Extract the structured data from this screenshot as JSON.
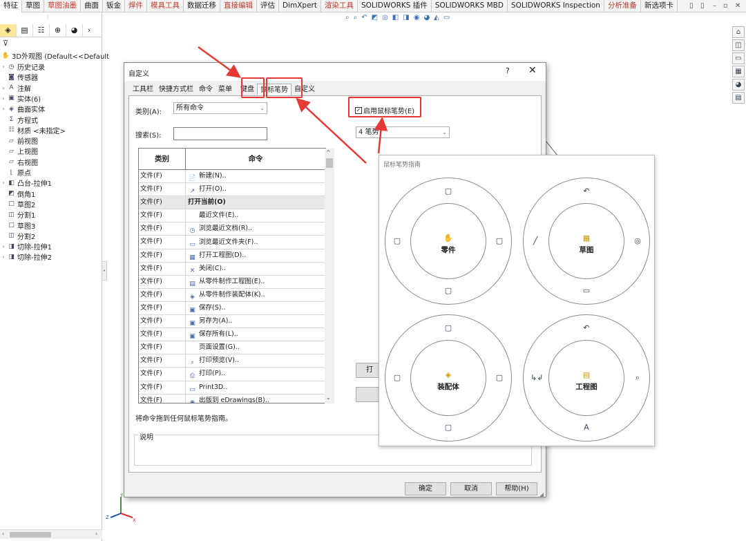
{
  "ribbon": {
    "tabs": [
      {
        "label": "特征",
        "style": "active"
      },
      {
        "label": "草图",
        "style": ""
      },
      {
        "label": "草图油墨",
        "style": "red"
      },
      {
        "label": "曲面",
        "style": ""
      },
      {
        "label": "钣金",
        "style": ""
      },
      {
        "label": "焊件",
        "style": "red"
      },
      {
        "label": "模具工具",
        "style": "red"
      },
      {
        "label": "数据迁移",
        "style": ""
      },
      {
        "label": "直接编辑",
        "style": "red"
      },
      {
        "label": "评估",
        "style": ""
      },
      {
        "label": "DimXpert",
        "style": ""
      },
      {
        "label": "渲染工具",
        "style": "red"
      },
      {
        "label": "SOLIDWORKS 插件",
        "style": ""
      },
      {
        "label": "SOLIDWORKS MBD",
        "style": ""
      },
      {
        "label": "SOLIDWORKS Inspection",
        "style": ""
      },
      {
        "label": "分析准备",
        "style": "red"
      },
      {
        "label": "新选项卡",
        "style": ""
      }
    ]
  },
  "tree": {
    "root": "3D外观图  (Default<<Default",
    "items": [
      {
        "label": "历史记录",
        "icon": "history-icon",
        "glyph": "◷",
        "expand": "›"
      },
      {
        "label": "传感器",
        "icon": "sensor-icon",
        "glyph": "◙",
        "expand": ""
      },
      {
        "label": "注解",
        "icon": "annotation-icon",
        "glyph": "A",
        "expand": "›"
      },
      {
        "label": "实体(6)",
        "icon": "solid-body-icon",
        "glyph": "▣",
        "expand": "›"
      },
      {
        "label": "曲面实体",
        "icon": "surface-body-icon",
        "glyph": "◈",
        "expand": "›"
      },
      {
        "label": "方程式",
        "icon": "equation-icon",
        "glyph": "Σ",
        "expand": ""
      },
      {
        "label": "材质 <未指定>",
        "icon": "material-icon",
        "glyph": "☷",
        "expand": ""
      },
      {
        "label": "前视图",
        "icon": "plane-icon",
        "glyph": "▱",
        "expand": ""
      },
      {
        "label": "上视图",
        "icon": "plane-icon",
        "glyph": "▱",
        "expand": ""
      },
      {
        "label": "右视图",
        "icon": "plane-icon",
        "glyph": "▱",
        "expand": ""
      },
      {
        "label": "原点",
        "icon": "origin-icon",
        "glyph": "⌊",
        "expand": ""
      },
      {
        "label": "凸台-拉伸1",
        "icon": "extrude-icon",
        "glyph": "◧",
        "expand": "›"
      },
      {
        "label": "倒角1",
        "icon": "chamfer-icon",
        "glyph": "◩",
        "expand": ""
      },
      {
        "label": "草图2",
        "icon": "sketch-icon",
        "glyph": "□",
        "expand": ""
      },
      {
        "label": "分割1",
        "icon": "split-icon",
        "glyph": "◫",
        "expand": ""
      },
      {
        "label": "草图3",
        "icon": "sketch-icon",
        "glyph": "□",
        "expand": ""
      },
      {
        "label": "分割2",
        "icon": "split-icon",
        "glyph": "◫",
        "expand": ""
      },
      {
        "label": "切除-拉伸1",
        "icon": "cut-extrude-icon",
        "glyph": "◨",
        "expand": "›"
      },
      {
        "label": "切除-拉伸2",
        "icon": "cut-extrude-icon",
        "glyph": "◨",
        "expand": "›"
      }
    ]
  },
  "dialog": {
    "title": "自定义",
    "help": "?",
    "close": "✕",
    "tabs": [
      "工具栏",
      "快捷方式栏",
      "命令",
      "菜单",
      "键盘",
      "鼠标笔势",
      "自定义"
    ],
    "category_label": "类别(A):",
    "category_value": "所有命令",
    "search_label": "搜索(S):",
    "enable_gestures_label": "启用鼠标笔势(E)",
    "gesture_count_value": "4 笔势",
    "table_headers": [
      "类别",
      "命令"
    ],
    "rows": [
      {
        "cat": "文件(F)",
        "cmd": "新建(N)..",
        "icon": "new-file-icon",
        "glyph": "📄",
        "hl": false
      },
      {
        "cat": "文件(F)",
        "cmd": "打开(O)..",
        "icon": "open-icon",
        "glyph": "↗",
        "hl": false
      },
      {
        "cat": "文件(F)",
        "cmd": "打开当前(O)",
        "icon": "",
        "glyph": "",
        "hl": true
      },
      {
        "cat": "文件(F)",
        "cmd": "最近文件(E)..",
        "icon": "",
        "glyph": "",
        "hl": false
      },
      {
        "cat": "文件(F)",
        "cmd": "浏览最近文档(R)..",
        "icon": "recent-docs-icon",
        "glyph": "◷",
        "hl": false
      },
      {
        "cat": "文件(F)",
        "cmd": "浏览最近文件夹(F)..",
        "icon": "recent-folder-icon",
        "glyph": "▭",
        "hl": false
      },
      {
        "cat": "文件(F)",
        "cmd": "打开工程图(D)..",
        "icon": "drawing-icon",
        "glyph": "▦",
        "hl": false
      },
      {
        "cat": "文件(F)",
        "cmd": "关闭(C)..",
        "icon": "close-doc-icon",
        "glyph": "✕",
        "hl": false
      },
      {
        "cat": "文件(F)",
        "cmd": "从零件制作工程图(E)..",
        "icon": "make-drawing-icon",
        "glyph": "▤",
        "hl": false
      },
      {
        "cat": "文件(F)",
        "cmd": "从零件制作装配体(K)..",
        "icon": "make-assembly-icon",
        "glyph": "◈",
        "hl": false
      },
      {
        "cat": "文件(F)",
        "cmd": "保存(S)..",
        "icon": "save-icon",
        "glyph": "▣",
        "hl": false
      },
      {
        "cat": "文件(F)",
        "cmd": "另存为(A)..",
        "icon": "save-as-icon",
        "glyph": "▣",
        "hl": false
      },
      {
        "cat": "文件(F)",
        "cmd": "保存所有(L)..",
        "icon": "save-all-icon",
        "glyph": "▣",
        "hl": false
      },
      {
        "cat": "文件(F)",
        "cmd": "页面设置(G)..",
        "icon": "",
        "glyph": "",
        "hl": false
      },
      {
        "cat": "文件(F)",
        "cmd": "打印预览(V)..",
        "icon": "print-preview-icon",
        "glyph": "⌕",
        "hl": false
      },
      {
        "cat": "文件(F)",
        "cmd": "打印(P)..",
        "icon": "print-icon",
        "glyph": "⎙",
        "hl": false
      },
      {
        "cat": "文件(F)",
        "cmd": "Print3D..",
        "icon": "print3d-icon",
        "glyph": "▭",
        "hl": false
      },
      {
        "cat": "文件(F)",
        "cmd": "出版到 eDrawings(B)..",
        "icon": "edrawings-icon",
        "glyph": "◉",
        "hl": false
      }
    ],
    "drag_hint": "将命令拖到任何鼠标笔势指南。",
    "description_label": "说明",
    "side_button_label": "打",
    "ok": "确定",
    "cancel": "取消",
    "help_btn": "帮助(H)"
  },
  "guide": {
    "title": "鼠标笔势指南",
    "wheels": [
      {
        "label": "零件",
        "center_glyph": "✋",
        "top": "▢",
        "bottom": "▢",
        "left": "▢",
        "right": "▢"
      },
      {
        "label": "草图",
        "center_glyph": "▦",
        "top": "↶",
        "bottom": "▭",
        "left": "╱",
        "right": "◎"
      },
      {
        "label": "装配体",
        "center_glyph": "◈",
        "top": "▢",
        "bottom": "▢",
        "left": "▢",
        "right": "▢"
      },
      {
        "label": "工程图",
        "center_glyph": "▤",
        "top": "↶",
        "bottom": "A",
        "left": "↳↲",
        "right": "⌕"
      }
    ]
  },
  "colors": {
    "highlight": "#e53935"
  }
}
